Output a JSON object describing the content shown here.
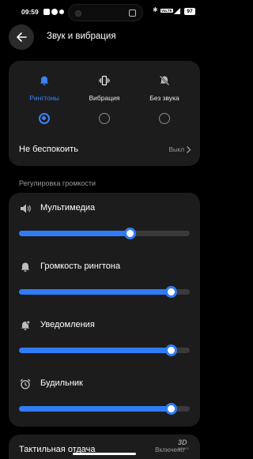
{
  "status_bar": {
    "time": "09:59",
    "battery": "97",
    "network_badge": "VoLTE"
  },
  "header": {
    "title": "Звук и вибрация",
    "back_icon": "arrow-left-icon"
  },
  "modes": [
    {
      "label": "Рингтоны",
      "icon": "bell-icon",
      "selected": true
    },
    {
      "label": "Вибрация",
      "icon": "vibrate-icon",
      "selected": false
    },
    {
      "label": "Без звука",
      "icon": "bell-off-icon",
      "selected": false
    }
  ],
  "do_not_disturb": {
    "label": "Не беспокоить",
    "value": "Выкл"
  },
  "volume_section": {
    "title": "Регулировка громкости",
    "items": [
      {
        "label": "Мультимедиа",
        "icon": "speaker-icon",
        "level": 0.65
      },
      {
        "label": "Громкость рингтона",
        "icon": "bell-icon",
        "level": 0.89
      },
      {
        "label": "Уведомления",
        "icon": "notification-bell-icon",
        "level": 0.89
      },
      {
        "label": "Будильник",
        "icon": "alarm-clock-icon",
        "level": 0.89
      }
    ]
  },
  "haptics": {
    "label": "Тактильная отдача",
    "value": "Включено"
  },
  "watermark": {
    "main": "3D",
    "sub": "NEWS"
  },
  "colors": {
    "accent": "#2f7cf6",
    "card": "#1c1c1c",
    "background": "#000000"
  }
}
